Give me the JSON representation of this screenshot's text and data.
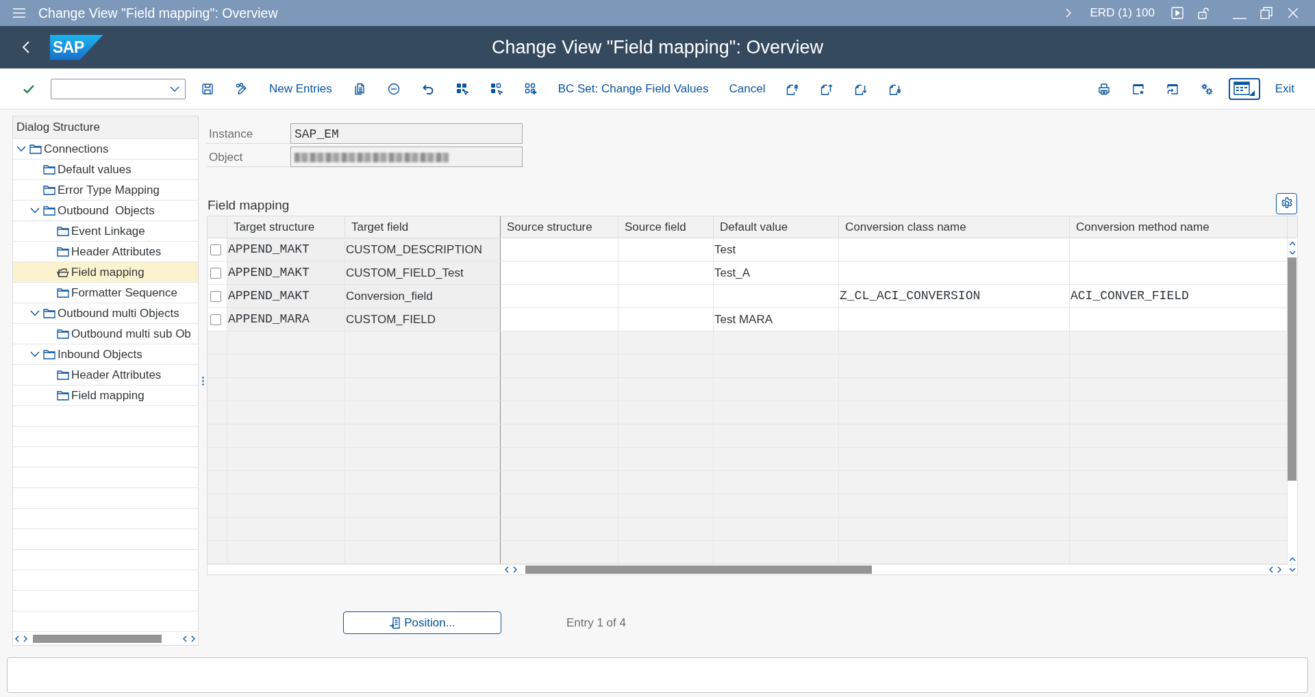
{
  "title_bar": {
    "title": "Change View \"Field mapping\": Overview",
    "system": "ERD (1) 100"
  },
  "header": {
    "logo": "SAP",
    "title": "Change View \"Field mapping\": Overview"
  },
  "toolbar": {
    "new_entries": "New Entries",
    "bc_set": "BC Set: Change Field Values",
    "cancel": "Cancel",
    "exit": "Exit"
  },
  "dialog_structure": {
    "title": "Dialog Structure",
    "tree": [
      {
        "label": "Connections",
        "selected": false,
        "expanded": true,
        "children": [
          {
            "label": "Default values",
            "selected": false
          },
          {
            "label": "Error Type Mapping",
            "selected": false
          },
          {
            "label": "Outbound  Objects",
            "selected": false,
            "expanded": true,
            "children": [
              {
                "label": "Event Linkage",
                "selected": false
              },
              {
                "label": "Header Attributes",
                "selected": false
              },
              {
                "label": "Field mapping",
                "selected": true
              },
              {
                "label": "Formatter Sequence",
                "selected": false
              }
            ]
          },
          {
            "label": "Outbound multi Objects",
            "selected": false,
            "expanded": true,
            "children": [
              {
                "label": "Outbound multi sub Ob",
                "selected": false
              }
            ]
          },
          {
            "label": "Inbound Objects",
            "selected": false,
            "expanded": true,
            "children": [
              {
                "label": "Header Attributes",
                "selected": false
              },
              {
                "label": "Field mapping",
                "selected": false
              }
            ]
          }
        ]
      }
    ]
  },
  "header_fields": [
    {
      "label": "Instance",
      "value": "SAP_EM"
    },
    {
      "label": "Object",
      "redacted": true
    }
  ],
  "table": {
    "title": "Field mapping",
    "columns": [
      "Target structure",
      "Target field",
      "Source structure",
      "Source field",
      "Default value",
      "Conversion class name",
      "Conversion method name"
    ],
    "rows": [
      {
        "selected": false,
        "target_structure": "APPEND_MAKT",
        "target_field": "CUSTOM_DESCRIPTION",
        "default_value": "Test"
      },
      {
        "selected": false,
        "target_structure": "APPEND_MAKT",
        "target_field": "CUSTOM_FIELD_Test",
        "default_value": "Test_A"
      },
      {
        "selected": false,
        "target_structure": "APPEND_MAKT",
        "target_field": "Conversion_field",
        "conversion_class_name": "Z_CL_ACI_CONVERSION",
        "conversion_method_name": "ACI_CONVER_FIELD"
      },
      {
        "selected": false,
        "target_structure": "APPEND_MARA",
        "target_field": "CUSTOM_FIELD",
        "default_value": "Test MARA"
      }
    ]
  },
  "position_button": "Position...",
  "entry_info": "Entry 1 of 4"
}
